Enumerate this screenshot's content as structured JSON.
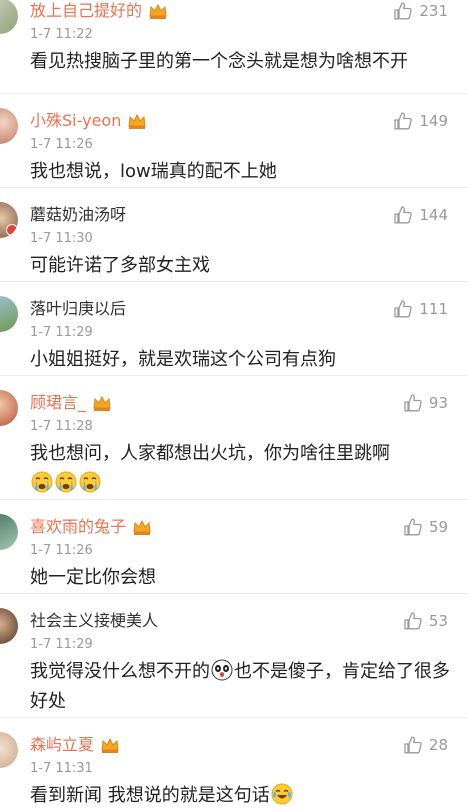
{
  "comments": [
    {
      "name": "放上自己提好的",
      "vip": true,
      "time": "1-7 11:22",
      "likes": "231",
      "content": "看见热搜脑子里的第一个念头就是想为啥想不开"
    },
    {
      "name": "小殊Si-yeon",
      "vip": true,
      "time": "1-7 11:26",
      "likes": "149",
      "content": "我也想说，low瑞真的配不上她"
    },
    {
      "name": "蘑菇奶油汤呀",
      "vip": false,
      "time": "1-7 11:30",
      "likes": "144",
      "content": "可能许诺了多部女主戏"
    },
    {
      "name": "落叶归庚以后",
      "vip": false,
      "time": "1-7 11:29",
      "likes": "111",
      "content": "小姐姐挺好，就是欢瑞这个公司有点狗"
    },
    {
      "name": "顾珺言_",
      "vip": true,
      "time": "1-7 11:28",
      "likes": "93",
      "content": "我也想问，人家都想出火坑，你为啥往里跳啊",
      "emoji_line": [
        "crying-emoji",
        "crying-emoji",
        "crying-emoji"
      ]
    },
    {
      "name": "喜欢雨的兔子",
      "vip": true,
      "time": "1-7 11:26",
      "likes": "59",
      "content": "她一定比你会想"
    },
    {
      "name": "社会主义接梗美人",
      "vip": false,
      "time": "1-7 11:29",
      "likes": "53",
      "content_before": "我觉得没什么想不开的",
      "content_emoji": "shocked-panda-emoji",
      "content_after": "也不是傻子，肯定给了很多好处"
    },
    {
      "name": "森屿立夏",
      "vip": true,
      "time": "1-7 11:31",
      "likes": "28",
      "content": "看到新闻 我想说的就是这句话",
      "content_emoji": "tears-of-joy-emoji"
    }
  ],
  "colors": {
    "vip_name": "#eb7350",
    "normal_name": "#333333",
    "meta": "#9a9a9a",
    "text": "#222222",
    "divider": "#ececec"
  }
}
